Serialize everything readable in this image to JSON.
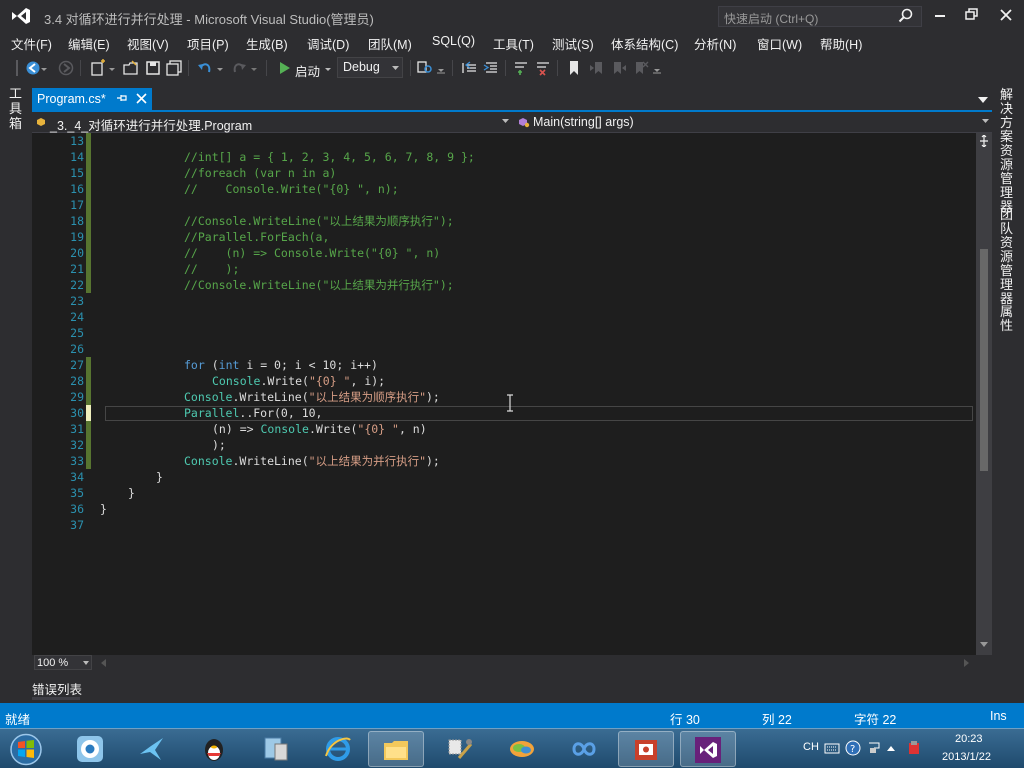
{
  "window": {
    "title": "3.4 对循环进行并行处理 - Microsoft Visual Studio(管理员)",
    "quick_launch_placeholder": "快速启动 (Ctrl+Q)"
  },
  "menu": [
    "文件(F)",
    "编辑(E)",
    "视图(V)",
    "项目(P)",
    "生成(B)",
    "调试(D)",
    "团队(M)",
    "SQL(Q)",
    "工具(T)",
    "测试(S)",
    "体系结构(C)",
    "分析(N)",
    "窗口(W)",
    "帮助(H)"
  ],
  "toolbar": {
    "start_label": "启动",
    "configuration": "Debug"
  },
  "side_panels": {
    "left": "工具箱",
    "right": [
      "解决方案资源管理器",
      "团队资源管理器",
      "属性"
    ]
  },
  "tab": {
    "title": "Program.cs*"
  },
  "navigation": {
    "type_member": "_3._4_对循环进行并行处理.Program",
    "method": "Main(string[] args)"
  },
  "code": {
    "current_line": 30,
    "lines": [
      {
        "num": "13",
        "indent": 0,
        "change": "green",
        "tokens": []
      },
      {
        "num": "14",
        "indent": 12,
        "change": "green",
        "tokens": [
          {
            "t": "//int[] a = { 1, 2, 3, 4, 5, 6, 7, 8, 9 };",
            "c": "comment"
          }
        ]
      },
      {
        "num": "15",
        "indent": 12,
        "change": "green",
        "tokens": [
          {
            "t": "//foreach (var n in a)",
            "c": "comment"
          }
        ]
      },
      {
        "num": "16",
        "indent": 12,
        "change": "green",
        "tokens": [
          {
            "t": "//    Console.Write(\"{0} \", n);",
            "c": "comment"
          }
        ]
      },
      {
        "num": "17",
        "indent": 0,
        "change": "green",
        "tokens": []
      },
      {
        "num": "18",
        "indent": 12,
        "change": "green",
        "tokens": [
          {
            "t": "//Console.WriteLine(\"以上结果为顺序执行\");",
            "c": "comment"
          }
        ]
      },
      {
        "num": "19",
        "indent": 12,
        "change": "green",
        "tokens": [
          {
            "t": "//Parallel.ForEach(a,",
            "c": "comment"
          }
        ]
      },
      {
        "num": "20",
        "indent": 12,
        "change": "green",
        "tokens": [
          {
            "t": "//    (n) => Console.Write(\"{0} \", n)",
            "c": "comment"
          }
        ]
      },
      {
        "num": "21",
        "indent": 12,
        "change": "green",
        "tokens": [
          {
            "t": "//    );",
            "c": "comment"
          }
        ]
      },
      {
        "num": "22",
        "indent": 12,
        "change": "green",
        "tokens": [
          {
            "t": "//Console.WriteLine(\"以上结果为并行执行\");",
            "c": "comment"
          }
        ]
      },
      {
        "num": "23",
        "indent": 0,
        "change": "none",
        "tokens": []
      },
      {
        "num": "24",
        "indent": 0,
        "change": "none",
        "tokens": []
      },
      {
        "num": "25",
        "indent": 0,
        "change": "none",
        "tokens": []
      },
      {
        "num": "26",
        "indent": 0,
        "change": "none",
        "tokens": []
      },
      {
        "num": "27",
        "indent": 12,
        "change": "green",
        "tokens": [
          {
            "t": "for",
            "c": "kw"
          },
          {
            "t": " (",
            "c": "text"
          },
          {
            "t": "int",
            "c": "kw"
          },
          {
            "t": " i = 0; i < 10; i++)",
            "c": "text"
          }
        ]
      },
      {
        "num": "28",
        "indent": 16,
        "change": "green",
        "tokens": [
          {
            "t": "Console",
            "c": "type"
          },
          {
            "t": ".Write(",
            "c": "text"
          },
          {
            "t": "\"{0} \"",
            "c": "str"
          },
          {
            "t": ", i);",
            "c": "text"
          }
        ]
      },
      {
        "num": "29",
        "indent": 12,
        "change": "green",
        "tokens": [
          {
            "t": "Console",
            "c": "type"
          },
          {
            "t": ".WriteLine(",
            "c": "text"
          },
          {
            "t": "\"以上结果为顺序执行\"",
            "c": "str"
          },
          {
            "t": ");",
            "c": "text"
          }
        ]
      },
      {
        "num": "30",
        "indent": 12,
        "change": "yellow",
        "tokens": [
          {
            "t": "Parallel",
            "c": "type"
          },
          {
            "t": "..For(0, 10,",
            "c": "text"
          }
        ]
      },
      {
        "num": "31",
        "indent": 16,
        "change": "green",
        "tokens": [
          {
            "t": "(n) => ",
            "c": "text"
          },
          {
            "t": "Console",
            "c": "type"
          },
          {
            "t": ".Write(",
            "c": "text"
          },
          {
            "t": "\"{0} \"",
            "c": "str"
          },
          {
            "t": ", n)",
            "c": "text"
          }
        ]
      },
      {
        "num": "32",
        "indent": 16,
        "change": "green",
        "tokens": [
          {
            "t": ");",
            "c": "text"
          }
        ]
      },
      {
        "num": "33",
        "indent": 12,
        "change": "green",
        "tokens": [
          {
            "t": "Console",
            "c": "type"
          },
          {
            "t": ".WriteLine(",
            "c": "text"
          },
          {
            "t": "\"以上结果为并行执行\"",
            "c": "str"
          },
          {
            "t": ");",
            "c": "text"
          }
        ]
      },
      {
        "num": "34",
        "indent": 8,
        "change": "none",
        "tokens": [
          {
            "t": "}",
            "c": "text"
          }
        ]
      },
      {
        "num": "35",
        "indent": 4,
        "change": "none",
        "tokens": [
          {
            "t": "}",
            "c": "text"
          }
        ]
      },
      {
        "num": "36",
        "indent": 0,
        "change": "none",
        "tokens": [
          {
            "t": "}",
            "c": "text"
          }
        ]
      },
      {
        "num": "37",
        "indent": 0,
        "change": "none",
        "tokens": []
      }
    ]
  },
  "editor_footer": {
    "zoom": "100 %"
  },
  "error_list_tab": "错误列表",
  "status": {
    "ready": "就绪",
    "line": "行 30",
    "column": "列 22",
    "char": "字符 22",
    "mode": "Ins"
  },
  "taskbar": {
    "ime": "CH",
    "time": "20:23",
    "date": "2013/1/22"
  },
  "colors": {
    "accent": "#007acc",
    "change_saved": "#577430",
    "change_unsaved": "#efefbd"
  }
}
